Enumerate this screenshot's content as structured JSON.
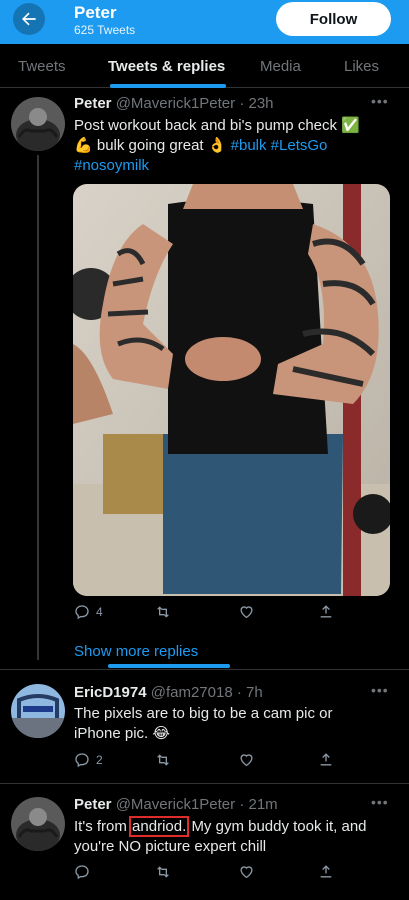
{
  "header": {
    "name": "Peter",
    "tweet_count": "625 Tweets",
    "follow_label": "Follow"
  },
  "tabs": [
    {
      "label": "Tweets"
    },
    {
      "label": "Tweets & replies"
    },
    {
      "label": "Media"
    },
    {
      "label": "Likes"
    }
  ],
  "tweet1": {
    "name": "Peter",
    "handle": "@Maverick1Peter",
    "time": "· 23h",
    "line1": "Post workout back and bi's pump check",
    "line2_text": "bulk going great",
    "hashtag_bulk": "#bulk",
    "hashtag_letsgo": "#LetsGo",
    "hashtag_nosoymilk": "#nosoymilk",
    "reply_count": "4",
    "emoji_check": "✅",
    "emoji_flex": "💪",
    "emoji_ok": "👌"
  },
  "show_more": "Show more replies",
  "tweet2": {
    "name": "EricD1974",
    "handle": "@fam27018",
    "time": "· 7h",
    "line1": "The pixels are to big to be a cam pic or",
    "line2": "iPhone pic.",
    "reply_count": "2",
    "emoji": "😂"
  },
  "tweet3": {
    "name": "Peter",
    "handle": "@Maverick1Peter",
    "time": "· 21m",
    "pre": "It's from",
    "highlighted": "andriod.",
    "post": "My gym buddy took it, and",
    "line2": "you're NO picture expert chill"
  },
  "colors": {
    "accent": "#1d9bf0",
    "background": "#000000",
    "highlight_box": "#e02b2b"
  }
}
